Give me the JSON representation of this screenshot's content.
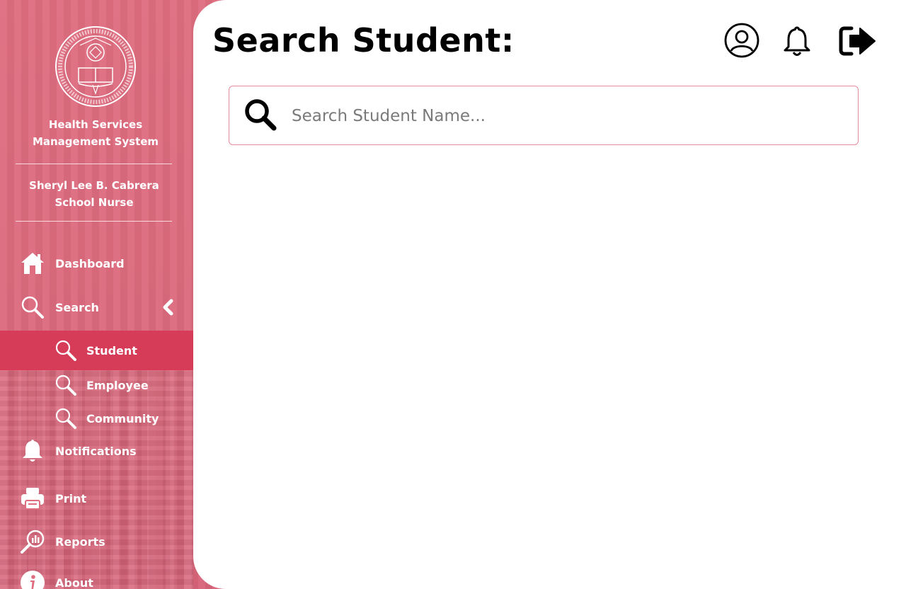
{
  "app": {
    "system_title_line1": "Health Services",
    "system_title_line2": "Management System"
  },
  "user": {
    "name": "Sheryl Lee B. Cabrera",
    "role": "School Nurse"
  },
  "nav": {
    "dashboard": "Dashboard",
    "search": "Search",
    "search_sub": {
      "student": "Student",
      "employee": "Employee",
      "community": "Community"
    },
    "notifications": "Notifications",
    "print": "Print",
    "reports": "Reports",
    "about": "About"
  },
  "header": {
    "title": "Search Student:",
    "icons": [
      "user-circle-icon",
      "bell-icon",
      "sign-out-icon"
    ]
  },
  "search": {
    "placeholder": "Search Student Name...",
    "value": ""
  },
  "colors": {
    "sidebar_bg": "#df6d80",
    "active_item": "#d63b58",
    "search_border": "#e78b9b",
    "main_bg": "#ffffff"
  }
}
